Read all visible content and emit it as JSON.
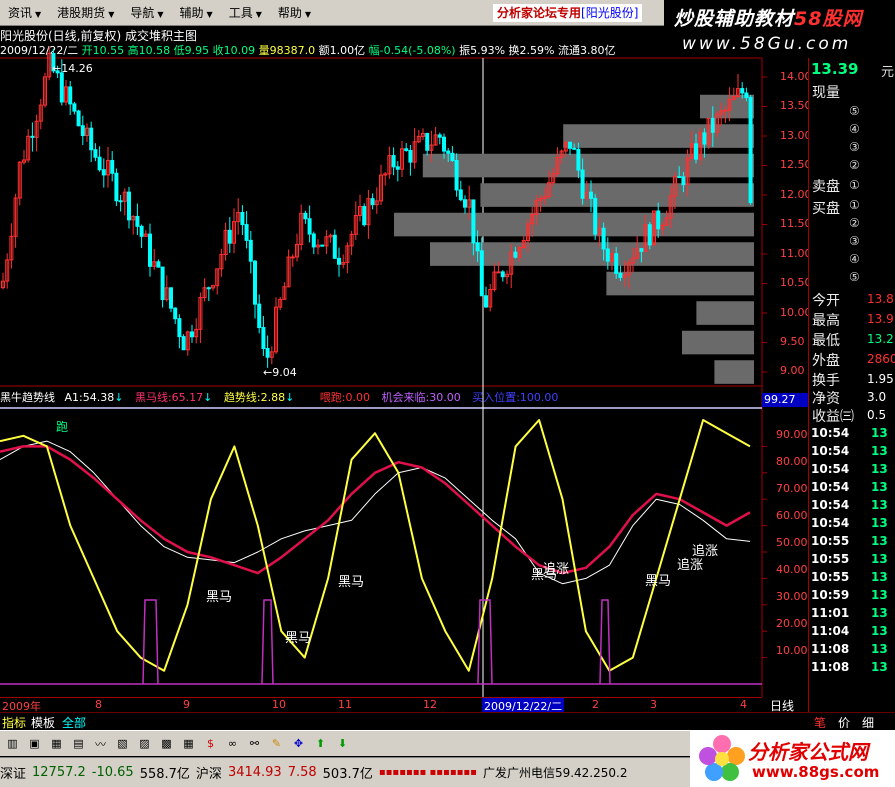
{
  "menu": [
    {
      "label": "资讯"
    },
    {
      "label": "港股期货"
    },
    {
      "label": "导航"
    },
    {
      "label": "辅助"
    },
    {
      "label": "工具"
    },
    {
      "label": "帮助"
    }
  ],
  "forum": {
    "text": "分析家论坛专用",
    "stock": "[阳光股份]"
  },
  "banner": {
    "title_a": "炒股辅助教材",
    "title_b": "58股网",
    "url": "www.58Gu.com"
  },
  "chart_title": "阳光股份(日线,前复权) 成交堆积主图",
  "info": {
    "date": "2009/12/22/二",
    "open_label": "开",
    "open": "10.55",
    "high_label": "高",
    "high": "10.58",
    "low_label": "低",
    "low": "9.95",
    "close_label": "收",
    "close": "10.09",
    "vol_label": "量",
    "vol": "98387.0",
    "amt_label": "额",
    "amt": "1.00亿",
    "chg_label": "幅",
    "chg": "-0.54(-5.08%)",
    "amp_label": "振",
    "amp": "5.93%",
    "turn_label": "换",
    "turn": "2.59%",
    "float_label": "流通",
    "float": "3.80亿"
  },
  "price_axis": [
    "14.00",
    "13.50",
    "13.00",
    "12.50",
    "12.00",
    "11.50",
    "11.00",
    "10.50",
    "10.00",
    "9.50",
    "9.00"
  ],
  "price_marks": {
    "high": "14.26",
    "low": "9.04"
  },
  "indicator": {
    "name": "黑牛趋势线",
    "a1": "A1:54.38",
    "heima": "黑马线:65.17",
    "trend": "趋势线:2.88",
    "hezi": "喂跑:0.00",
    "chance": "机会来临:30.00",
    "buy": "买入位置:100.00"
  },
  "ind_axis": [
    "99.27",
    "90.00",
    "80.00",
    "70.00",
    "60.00",
    "50.00",
    "40.00",
    "30.00",
    "20.00",
    "10.00"
  ],
  "annotations": {
    "pao": "跑",
    "heima": "黑马",
    "zhuizhang": "追涨"
  },
  "date_axis": {
    "year": "2009年",
    "m8": "8",
    "m9": "9",
    "m10": "10",
    "m11": "11",
    "m12": "12",
    "sel": "2009/12/22/二",
    "m2": "2",
    "m3": "3",
    "m4": "4"
  },
  "day_button": "日线",
  "tabs": {
    "t1": "指标",
    "t2": "模板",
    "t3": "全部"
  },
  "right": {
    "price": "13.39",
    "unit": "元",
    "xianliang": "现量",
    "sell": "卖盘",
    "buy": "买盘",
    "n5": "⑤",
    "n4": "④",
    "n3": "③",
    "n2": "②",
    "n1": "①",
    "open_l": "今开",
    "open_v": "13.8",
    "high_l": "最高",
    "high_v": "13.9",
    "low_l": "最低",
    "low_v": "13.2",
    "outer_l": "外盘",
    "outer_v": "2860",
    "turn_l": "换手",
    "turn_v": "1.95",
    "net_l": "净资",
    "net_v": "3.0",
    "eps_l": "收益㈢",
    "eps_v": "0.5",
    "ticks": [
      {
        "t": "10:54",
        "v": "13"
      },
      {
        "t": "10:54",
        "v": "13"
      },
      {
        "t": "10:54",
        "v": "13"
      },
      {
        "t": "10:54",
        "v": "13"
      },
      {
        "t": "10:54",
        "v": "13"
      },
      {
        "t": "10:54",
        "v": "13"
      },
      {
        "t": "10:55",
        "v": "13"
      },
      {
        "t": "10:55",
        "v": "13"
      },
      {
        "t": "10:55",
        "v": "13"
      },
      {
        "t": "10:59",
        "v": "13"
      },
      {
        "t": "11:01",
        "v": "13"
      },
      {
        "t": "11:04",
        "v": "13"
      },
      {
        "t": "11:08",
        "v": "13"
      },
      {
        "t": "11:08",
        "v": "13"
      }
    ],
    "bottom_tabs": {
      "b1": "笔",
      "b2": "价",
      "b3": "细"
    }
  },
  "status": {
    "sz_l": "深证",
    "sz_v": "12757.2",
    "sz_c": "-10.65",
    "sz_a": "558.7亿",
    "sh_l": "沪深",
    "sh_v": "3414.93",
    "sh_c": "7.58",
    "sh_a": "503.7亿",
    "isp": "广发广州电信59.42.250.2"
  },
  "logo": {
    "text": "分析家公式网",
    "url": "www.88gs.com"
  },
  "colors": {
    "up": "#ff3030",
    "down": "#00ffff",
    "yellow": "#ffff40",
    "red_line": "#e0104a",
    "white_line": "#ffffff",
    "magenta": "#c030c0"
  },
  "chart_data": {
    "type": "line",
    "title": "阳光股份(日线,前复权) 成交堆积主图",
    "price_ylim": [
      9.0,
      14.0
    ],
    "series": [
      {
        "name": "A1",
        "values": [
          85,
          90,
          92,
          88,
          80,
          70,
          60,
          52,
          48,
          47,
          46,
          50,
          55,
          58,
          60,
          62,
          72,
          80,
          82,
          78,
          70,
          62,
          55,
          42,
          38,
          40,
          45,
          60,
          70,
          68,
          62,
          55,
          54
        ]
      },
      {
        "name": "黑马线",
        "values": [
          88,
          90,
          90,
          85,
          78,
          70,
          62,
          55,
          50,
          48,
          45,
          42,
          48,
          55,
          62,
          72,
          80,
          84,
          82,
          76,
          68,
          60,
          52,
          45,
          42,
          44,
          52,
          64,
          72,
          70,
          65,
          60,
          65
        ]
      },
      {
        "name": "趋势线",
        "values": [
          92,
          94,
          90,
          60,
          40,
          20,
          10,
          5,
          30,
          70,
          90,
          60,
          20,
          10,
          40,
          85,
          95,
          80,
          40,
          20,
          5,
          40,
          90,
          100,
          70,
          20,
          5,
          10,
          40,
          70,
          100,
          95,
          90
        ]
      }
    ],
    "ind_ylim": [
      0,
      100
    ],
    "volume_profile_note": "成交堆积"
  }
}
